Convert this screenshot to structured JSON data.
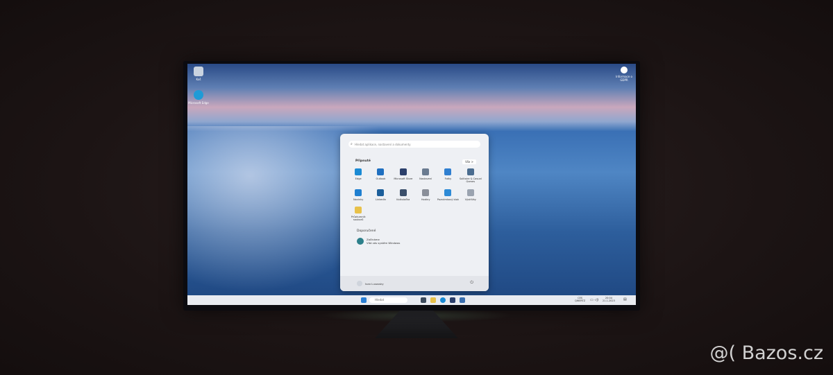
{
  "desktop": {
    "icons": [
      {
        "label": "Koš"
      },
      {
        "label": "Microsoft Edge"
      }
    ],
    "widget_label": "Informace o GDPR"
  },
  "start_menu": {
    "search_placeholder": "Hledat aplikace, nastavení a dokumenty",
    "pinned_title": "Připnuté",
    "all_button": "Vše >",
    "pinned": [
      {
        "label": "Edge",
        "color": "#1a8ad4"
      },
      {
        "label": "Outlook",
        "color": "#1f6fc0"
      },
      {
        "label": "Microsoft Store",
        "color": "#2b3f6b"
      },
      {
        "label": "Nastavení",
        "color": "#6a7b90"
      },
      {
        "label": "Fotky",
        "color": "#2f7fd0"
      },
      {
        "label": "Solitaire & Casual Games",
        "color": "#4a6c8f"
      },
      {
        "label": "Novinky",
        "color": "#1f7fd0"
      },
      {
        "label": "LinkedIn",
        "color": "#1b5e9a"
      },
      {
        "label": "Kalkulačka",
        "color": "#3b4f6b"
      },
      {
        "label": "Hodiny",
        "color": "#8a8f99"
      },
      {
        "label": "Poznámkový blok",
        "color": "#2d8ad6"
      },
      {
        "label": "Výstřižky",
        "color": "#9aa3b0"
      },
      {
        "label": "Průzkumník souborů",
        "color": "#e8c14a"
      }
    ],
    "recommended_title": "Doporučené",
    "recommended": [
      {
        "title": "Začínáme",
        "subtitle": "Vítá vás systém Windows"
      }
    ],
    "user_name": "Ivan Lusovsky"
  },
  "taskbar": {
    "search_label": "Hledat",
    "language": "CES",
    "layout": "QWERTZ",
    "time": "20:04",
    "date": "21.1.2023"
  },
  "watermark": "@( Bazos.cz"
}
